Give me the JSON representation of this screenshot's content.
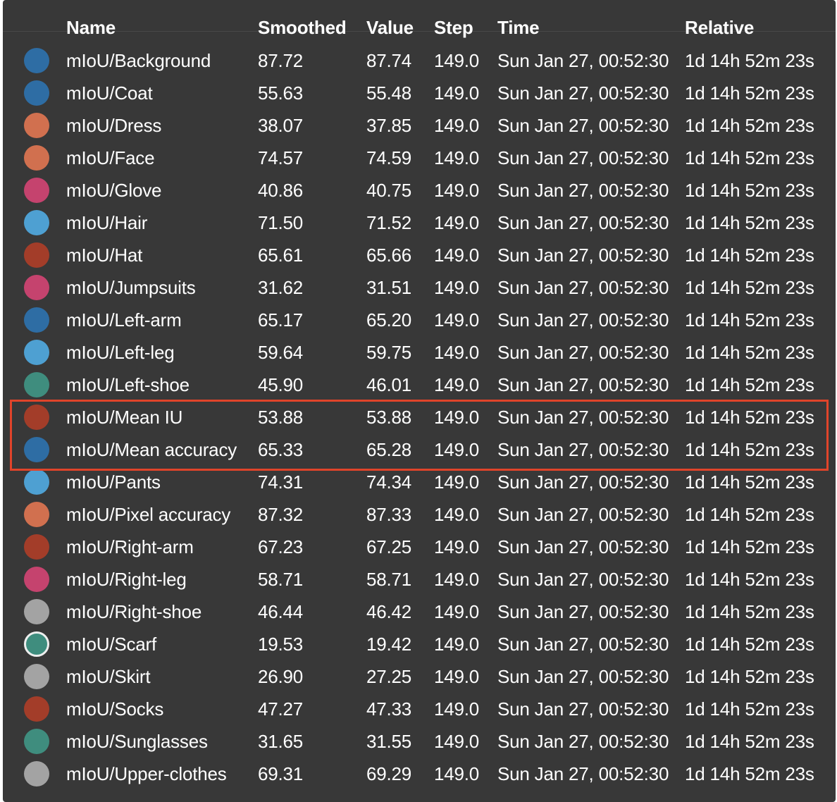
{
  "columns": {
    "name": "Name",
    "smoothed": "Smoothed",
    "value": "Value",
    "step": "Step",
    "time": "Time",
    "relative": "Relative"
  },
  "rows": [
    {
      "color": "#2e6da4",
      "ringed": false,
      "name": "mIoU/Background",
      "smoothed": "87.72",
      "value": "87.74",
      "step": "149.0",
      "time": "Sun Jan 27, 00:52:30",
      "relative": "1d 14h 52m 23s"
    },
    {
      "color": "#2e6da4",
      "ringed": false,
      "name": "mIoU/Coat",
      "smoothed": "55.63",
      "value": "55.48",
      "step": "149.0",
      "time": "Sun Jan 27, 00:52:30",
      "relative": "1d 14h 52m 23s"
    },
    {
      "color": "#d1704f",
      "ringed": false,
      "name": "mIoU/Dress",
      "smoothed": "38.07",
      "value": "37.85",
      "step": "149.0",
      "time": "Sun Jan 27, 00:52:30",
      "relative": "1d 14h 52m 23s"
    },
    {
      "color": "#d1704f",
      "ringed": false,
      "name": "mIoU/Face",
      "smoothed": "74.57",
      "value": "74.59",
      "step": "149.0",
      "time": "Sun Jan 27, 00:52:30",
      "relative": "1d 14h 52m 23s"
    },
    {
      "color": "#c5436e",
      "ringed": false,
      "name": "mIoU/Glove",
      "smoothed": "40.86",
      "value": "40.75",
      "step": "149.0",
      "time": "Sun Jan 27, 00:52:30",
      "relative": "1d 14h 52m 23s"
    },
    {
      "color": "#4ea0d2",
      "ringed": false,
      "name": "mIoU/Hair",
      "smoothed": "71.50",
      "value": "71.52",
      "step": "149.0",
      "time": "Sun Jan 27, 00:52:30",
      "relative": "1d 14h 52m 23s"
    },
    {
      "color": "#a33d29",
      "ringed": false,
      "name": "mIoU/Hat",
      "smoothed": "65.61",
      "value": "65.66",
      "step": "149.0",
      "time": "Sun Jan 27, 00:52:30",
      "relative": "1d 14h 52m 23s"
    },
    {
      "color": "#c5436e",
      "ringed": false,
      "name": "mIoU/Jumpsuits",
      "smoothed": "31.62",
      "value": "31.51",
      "step": "149.0",
      "time": "Sun Jan 27, 00:52:30",
      "relative": "1d 14h 52m 23s"
    },
    {
      "color": "#2e6da4",
      "ringed": false,
      "name": "mIoU/Left-arm",
      "smoothed": "65.17",
      "value": "65.20",
      "step": "149.0",
      "time": "Sun Jan 27, 00:52:30",
      "relative": "1d 14h 52m 23s"
    },
    {
      "color": "#4ea0d2",
      "ringed": false,
      "name": "mIoU/Left-leg",
      "smoothed": "59.64",
      "value": "59.75",
      "step": "149.0",
      "time": "Sun Jan 27, 00:52:30",
      "relative": "1d 14h 52m 23s"
    },
    {
      "color": "#3f8d7e",
      "ringed": false,
      "name": "mIoU/Left-shoe",
      "smoothed": "45.90",
      "value": "46.01",
      "step": "149.0",
      "time": "Sun Jan 27, 00:52:30",
      "relative": "1d 14h 52m 23s"
    },
    {
      "color": "#a33d29",
      "ringed": false,
      "name": "mIoU/Mean IU",
      "smoothed": "53.88",
      "value": "53.88",
      "step": "149.0",
      "time": "Sun Jan 27, 00:52:30",
      "relative": "1d 14h 52m 23s"
    },
    {
      "color": "#2e6da4",
      "ringed": false,
      "name": "mIoU/Mean accuracy",
      "smoothed": "65.33",
      "value": "65.28",
      "step": "149.0",
      "time": "Sun Jan 27, 00:52:30",
      "relative": "1d 14h 52m 23s"
    },
    {
      "color": "#4ea0d2",
      "ringed": false,
      "name": "mIoU/Pants",
      "smoothed": "74.31",
      "value": "74.34",
      "step": "149.0",
      "time": "Sun Jan 27, 00:52:30",
      "relative": "1d 14h 52m 23s"
    },
    {
      "color": "#d1704f",
      "ringed": false,
      "name": "mIoU/Pixel accuracy",
      "smoothed": "87.32",
      "value": "87.33",
      "step": "149.0",
      "time": "Sun Jan 27, 00:52:30",
      "relative": "1d 14h 52m 23s"
    },
    {
      "color": "#a33d29",
      "ringed": false,
      "name": "mIoU/Right-arm",
      "smoothed": "67.23",
      "value": "67.25",
      "step": "149.0",
      "time": "Sun Jan 27, 00:52:30",
      "relative": "1d 14h 52m 23s"
    },
    {
      "color": "#c5436e",
      "ringed": false,
      "name": "mIoU/Right-leg",
      "smoothed": "58.71",
      "value": "58.71",
      "step": "149.0",
      "time": "Sun Jan 27, 00:52:30",
      "relative": "1d 14h 52m 23s"
    },
    {
      "color": "#a3a3a3",
      "ringed": false,
      "name": "mIoU/Right-shoe",
      "smoothed": "46.44",
      "value": "46.42",
      "step": "149.0",
      "time": "Sun Jan 27, 00:52:30",
      "relative": "1d 14h 52m 23s"
    },
    {
      "color": "#3f8d7e",
      "ringed": true,
      "name": "mIoU/Scarf",
      "smoothed": "19.53",
      "value": "19.42",
      "step": "149.0",
      "time": "Sun Jan 27, 00:52:30",
      "relative": "1d 14h 52m 23s"
    },
    {
      "color": "#a3a3a3",
      "ringed": false,
      "name": "mIoU/Skirt",
      "smoothed": "26.90",
      "value": "27.25",
      "step": "149.0",
      "time": "Sun Jan 27, 00:52:30",
      "relative": "1d 14h 52m 23s"
    },
    {
      "color": "#a33d29",
      "ringed": false,
      "name": "mIoU/Socks",
      "smoothed": "47.27",
      "value": "47.33",
      "step": "149.0",
      "time": "Sun Jan 27, 00:52:30",
      "relative": "1d 14h 52m 23s"
    },
    {
      "color": "#3f8d7e",
      "ringed": false,
      "name": "mIoU/Sunglasses",
      "smoothed": "31.65",
      "value": "31.55",
      "step": "149.0",
      "time": "Sun Jan 27, 00:52:30",
      "relative": "1d 14h 52m 23s"
    },
    {
      "color": "#a3a3a3",
      "ringed": false,
      "name": "mIoU/Upper-clothes",
      "smoothed": "69.31",
      "value": "69.29",
      "step": "149.0",
      "time": "Sun Jan 27, 00:52:30",
      "relative": "1d 14h 52m 23s"
    }
  ],
  "highlight": {
    "color": "#e0442a",
    "rows": [
      "mIoU/Mean IU",
      "mIoU/Mean accuracy"
    ]
  }
}
